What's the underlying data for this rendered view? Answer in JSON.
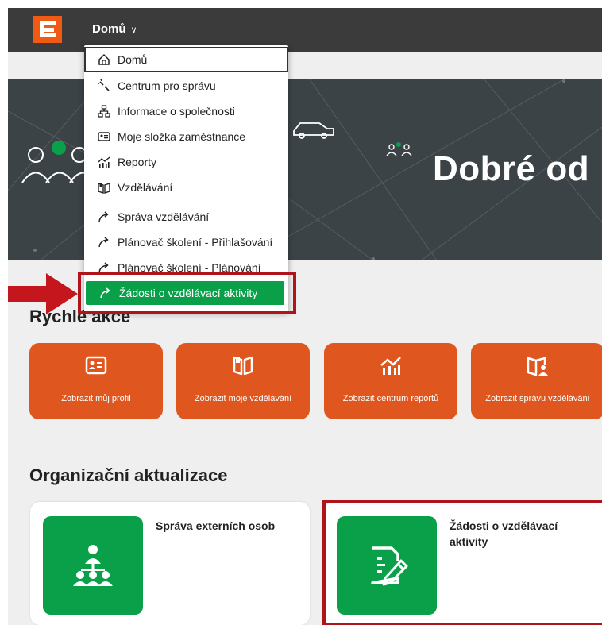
{
  "header": {
    "menu_label": "Domů",
    "menu_chevron": "chevron-down-icon",
    "brand_color": "#f05a12"
  },
  "hero": {
    "title": "Dobré od"
  },
  "menu": {
    "items": [
      {
        "label": "Domů",
        "icon": "home-icon"
      },
      {
        "label": "Centrum pro správu",
        "icon": "wrench-icon"
      },
      {
        "label": "Informace o společnosti",
        "icon": "org-chart-icon"
      },
      {
        "label": "Moje složka zaměstnance",
        "icon": "id-card-icon"
      },
      {
        "label": "Reporty",
        "icon": "chart-icon"
      },
      {
        "label": "Vzdělávání",
        "icon": "book-icon"
      },
      {
        "label": "Správa vzdělávání",
        "icon": "external-link-icon"
      },
      {
        "label": "Plánovač školení - Přihlašování",
        "icon": "external-link-icon"
      },
      {
        "label": "Plánovač školení - Plánování",
        "icon": "external-link-icon"
      },
      {
        "label": "Žádosti o vzdělávací aktivity",
        "icon": "external-link-icon"
      }
    ],
    "highlight_color": "#0aa04a"
  },
  "quick_actions": {
    "title": "Rychlé akce",
    "items": [
      {
        "label": "Zobrazit můj profil",
        "icon": "id-card-icon"
      },
      {
        "label": "Zobrazit moje vzdělávání",
        "icon": "book-icon"
      },
      {
        "label": "Zobrazit centrum reportů",
        "icon": "chart-icon"
      },
      {
        "label": "Zobrazit správu vzdělávání",
        "icon": "book-person-icon"
      }
    ],
    "color": "#e0561f"
  },
  "org_updates": {
    "title": "Organizační aktualizace",
    "cards": [
      {
        "title": "Správa externích osob",
        "icon": "people-hierarchy-icon"
      },
      {
        "title_line1": "Žádosti o vzdělávací",
        "title_line2": "aktivity",
        "icon": "document-pen-icon"
      }
    ]
  },
  "annotation_color": "#b0141b"
}
